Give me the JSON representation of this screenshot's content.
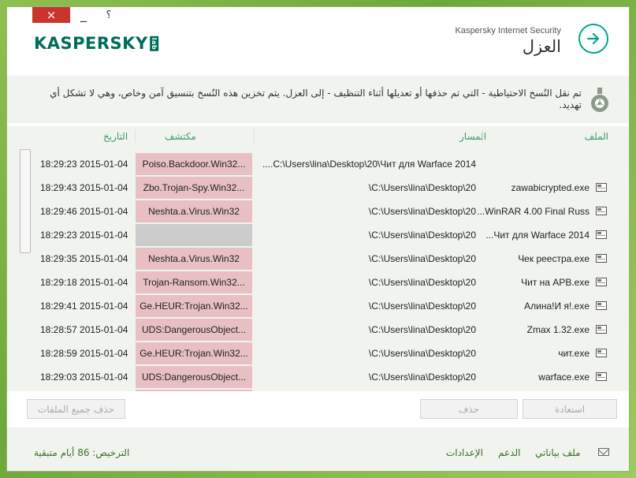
{
  "window": {
    "close_icon": "×",
    "minimize_icon": "_",
    "help_icon": "؟"
  },
  "header": {
    "logo": "KASPERSKY",
    "logo_lab": "lab",
    "app_title": "Kaspersky Internet Security",
    "page_title": "العزل",
    "back_icon": "arrow-right-icon"
  },
  "info": {
    "text": "تم نقل النُسخ الاحتياطية - التي تم حذفها أو تعديلها أثناء التنظيف - إلى العزل. يتم تخزين هذه النُسخ بتنسيق آمن وخاص، وهي لا تشكل أي تهديد.",
    "icon": "quarantine-flask-icon"
  },
  "table": {
    "headers": {
      "date": "التاريخ",
      "detected": "مكتشف",
      "path": "المسار",
      "file": "الملف"
    },
    "rows": [
      {
        "date": "18:29:23 2015-01-04",
        "detected": "Poiso.Backdoor.Win32...",
        "detected_style": "red",
        "path": "C:\\Users\\lina\\Desktop\\20\\Чит для Warface 2014....",
        "file": ""
      },
      {
        "date": "18:29:43 2015-01-04",
        "detected": "Zbo.Trojan-Spy.Win32...",
        "detected_style": "red",
        "path": "C:\\Users\\lina\\Desktop\\20\\",
        "file": "zawabicrypted.exe"
      },
      {
        "date": "18:29:46 2015-01-04",
        "detected": "Neshta.a.Virus.Win32",
        "detected_style": "red",
        "path": "C:\\Users\\lina\\Desktop\\20\\",
        "file": "WinRAR 4.00 Final Russ..."
      },
      {
        "date": "18:29:23 2015-01-04",
        "detected": "",
        "detected_style": "gray",
        "path": "C:\\Users\\lina\\Desktop\\20\\",
        "file": "Чит для Warface 2014..."
      },
      {
        "date": "18:29:35 2015-01-04",
        "detected": "Neshta.a.Virus.Win32",
        "detected_style": "red",
        "path": "C:\\Users\\lina\\Desktop\\20\\",
        "file": "Чек реестра.exe"
      },
      {
        "date": "18:29:18 2015-01-04",
        "detected": "Trojan-Ransom.Win32...",
        "detected_style": "red",
        "path": "C:\\Users\\lina\\Desktop\\20\\",
        "file": "Чит на АРВ.exe"
      },
      {
        "date": "18:29:41 2015-01-04",
        "detected": "Ge.HEUR:Trojan.Win32...",
        "detected_style": "red",
        "path": "C:\\Users\\lina\\Desktop\\20\\",
        "file": "Алина!И я!.exe"
      },
      {
        "date": "18:28:57 2015-01-04",
        "detected": "UDS:DangerousObject...",
        "detected_style": "red",
        "path": "C:\\Users\\lina\\Desktop\\20\\",
        "file": "Zmax 1.32.exe"
      },
      {
        "date": "18:28:59 2015-01-04",
        "detected": "Ge.HEUR:Trojan.Win32...",
        "detected_style": "red",
        "path": "C:\\Users\\lina\\Desktop\\20\\",
        "file": "чит.exe"
      },
      {
        "date": "18:29:03 2015-01-04",
        "detected": "UDS:DangerousObject...",
        "detected_style": "red",
        "path": "C:\\Users\\lina\\Desktop\\20\\",
        "file": "warface.exe"
      },
      {
        "date": "",
        "detected": "",
        "detected_style": "red",
        "path": "",
        "file": ""
      }
    ]
  },
  "buttons": {
    "delete_all": "حذف جميع الملفات",
    "delete": "حذف",
    "restore": "استعادة"
  },
  "footer": {
    "license": "الترخيص: 86  أيام متبقية",
    "settings": "الإعدادات",
    "support": "الدعم",
    "my_profile": "ملف بياناتي",
    "mail_icon": "envelope-icon"
  }
}
